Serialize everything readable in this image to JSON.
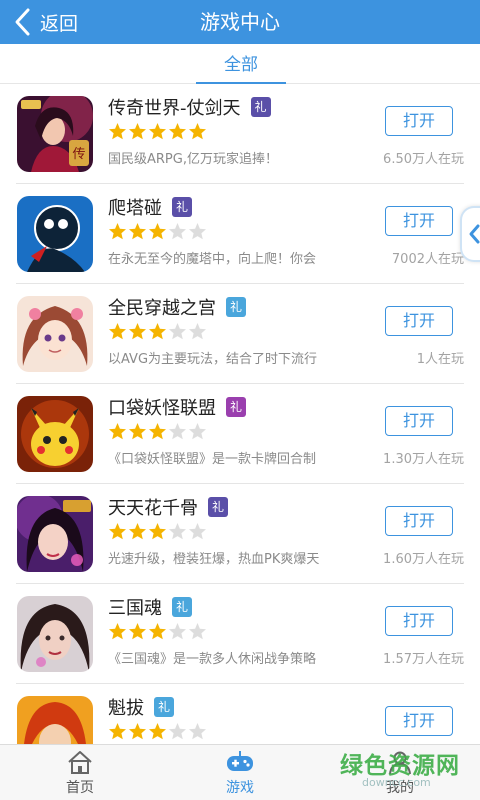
{
  "header": {
    "back_label": "返回",
    "title": "游戏中心"
  },
  "tabs": {
    "all_label": "全部"
  },
  "games": [
    {
      "name": "传奇世界-仗剑天",
      "gift": "礼",
      "gift_color": "#5a4fa8",
      "rating": 5,
      "desc": "国民级ARPG,亿万玩家追捧！",
      "players": "6.50万人在玩",
      "button": "打开",
      "icon": "legend-world-icon"
    },
    {
      "name": "爬塔碰",
      "gift": "礼",
      "gift_color": "#5a4fa8",
      "rating": 3,
      "desc": "在永无至今的魔塔中，向上爬！你会",
      "players": "7002人在玩",
      "button": "打开",
      "icon": "tower-climb-icon"
    },
    {
      "name": "全民穿越之宫",
      "gift": "礼",
      "gift_color": "#4aa6dc",
      "rating": 3,
      "desc": "以AVG为主要玩法，结合了时下流行",
      "players": "1人在玩",
      "button": "打开",
      "icon": "palace-girl-icon"
    },
    {
      "name": "口袋妖怪联盟",
      "gift": "礼",
      "gift_color": "#9a3fae",
      "rating": 3,
      "desc": "《口袋妖怪联盟》是一款卡牌回合制",
      "players": "1.30万人在玩",
      "button": "打开",
      "icon": "pikachu-icon"
    },
    {
      "name": "天天花千骨",
      "gift": "礼",
      "gift_color": "#5a4fa8",
      "rating": 3,
      "desc": "光速升级，橙装狂爆，热血PK爽爆天",
      "players": "1.60万人在玩",
      "button": "打开",
      "icon": "huaqiangu-icon"
    },
    {
      "name": "三国魂",
      "gift": "礼",
      "gift_color": "#4aa6dc",
      "rating": 3,
      "desc": "《三国魂》是一款多人休闲战争策略",
      "players": "1.57万人在玩",
      "button": "打开",
      "icon": "three-kingdoms-icon"
    },
    {
      "name": "魁拔",
      "gift": "礼",
      "gift_color": "#4aa6dc",
      "rating": 3,
      "desc": "",
      "players": "",
      "button": "打开",
      "icon": "kuiba-icon"
    }
  ],
  "bottom_nav": {
    "home_label": "首页",
    "games_label": "游戏",
    "mine_label": "我的"
  },
  "watermark": {
    "text": "绿色资源网",
    "url": "downcc.com"
  },
  "colors": {
    "accent": "#3d93df",
    "star_on": "#f5b400",
    "star_off": "#dddddd"
  }
}
